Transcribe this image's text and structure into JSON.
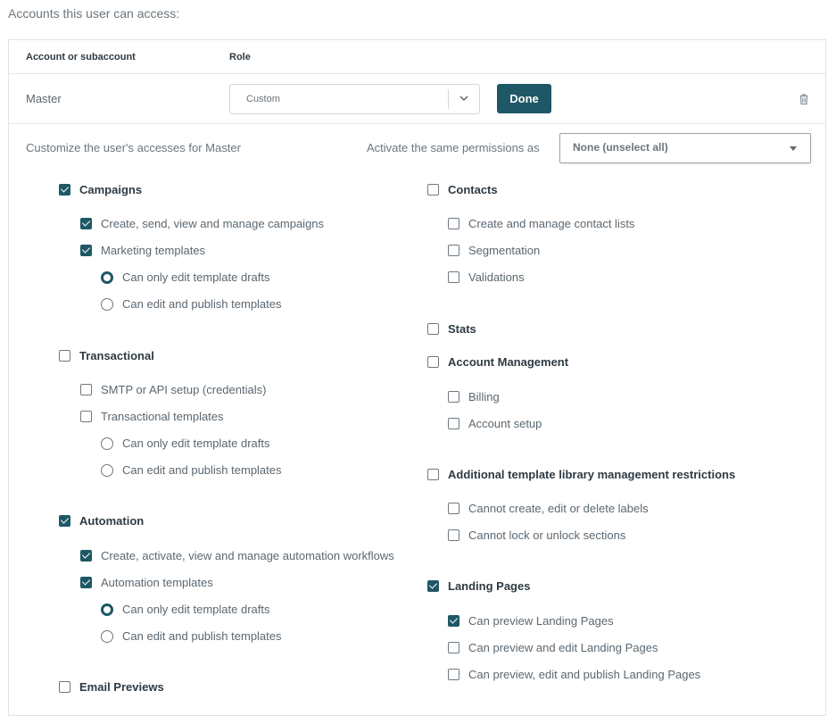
{
  "heading": "Accounts this user can access:",
  "table": {
    "col_account": "Account or subaccount",
    "col_role": "Role",
    "row": {
      "account": "Master",
      "role_value": "Custom",
      "done_label": "Done"
    }
  },
  "customize": {
    "title": "Customize the user's accesses for Master",
    "same_label": "Activate the same permissions as",
    "same_value": "None (unselect all)"
  },
  "left": {
    "campaigns": {
      "label": "Campaigns",
      "checked": true,
      "create": {
        "label": "Create, send, view and manage campaigns",
        "checked": true
      },
      "templates": {
        "label": "Marketing templates",
        "checked": true
      },
      "drafts": {
        "label": "Can only edit template drafts",
        "selected": true
      },
      "publish": {
        "label": "Can edit and publish templates",
        "selected": false
      }
    },
    "transactional": {
      "label": "Transactional",
      "checked": false,
      "smtp": {
        "label": "SMTP or API setup (credentials)",
        "checked": false
      },
      "templates": {
        "label": "Transactional templates",
        "checked": false
      },
      "drafts": {
        "label": "Can only edit template drafts",
        "selected": false
      },
      "publish": {
        "label": "Can edit and publish templates",
        "selected": false
      }
    },
    "automation": {
      "label": "Automation",
      "checked": true,
      "create": {
        "label": "Create, activate, view and manage automation workflows",
        "checked": true
      },
      "templates": {
        "label": "Automation templates",
        "checked": true
      },
      "drafts": {
        "label": "Can only edit template drafts",
        "selected": true
      },
      "publish": {
        "label": "Can edit and publish templates",
        "selected": false
      }
    },
    "email_previews": {
      "label": "Email Previews",
      "checked": false
    }
  },
  "right": {
    "contacts": {
      "label": "Contacts",
      "checked": false,
      "lists": {
        "label": "Create and manage contact lists",
        "checked": false
      },
      "segmentation": {
        "label": "Segmentation",
        "checked": false
      },
      "validations": {
        "label": "Validations",
        "checked": false
      }
    },
    "stats": {
      "label": "Stats",
      "checked": false
    },
    "account_mgmt": {
      "label": "Account Management",
      "checked": false,
      "billing": {
        "label": "Billing",
        "checked": false
      },
      "setup": {
        "label": "Account setup",
        "checked": false
      }
    },
    "library": {
      "label": "Additional template library management restrictions",
      "checked": false,
      "labels": {
        "label": "Cannot create, edit or delete labels",
        "checked": false
      },
      "sections": {
        "label": "Cannot lock or unlock sections",
        "checked": false
      }
    },
    "landing": {
      "label": "Landing Pages",
      "checked": true,
      "preview": {
        "label": "Can preview Landing Pages",
        "checked": true
      },
      "edit": {
        "label": "Can preview and edit Landing Pages",
        "checked": false
      },
      "publish": {
        "label": "Can preview, edit and publish Landing Pages",
        "checked": false
      }
    }
  },
  "colors": {
    "accent": "#1e5866",
    "text": "#5b6770",
    "border": "#dfe3e6"
  }
}
